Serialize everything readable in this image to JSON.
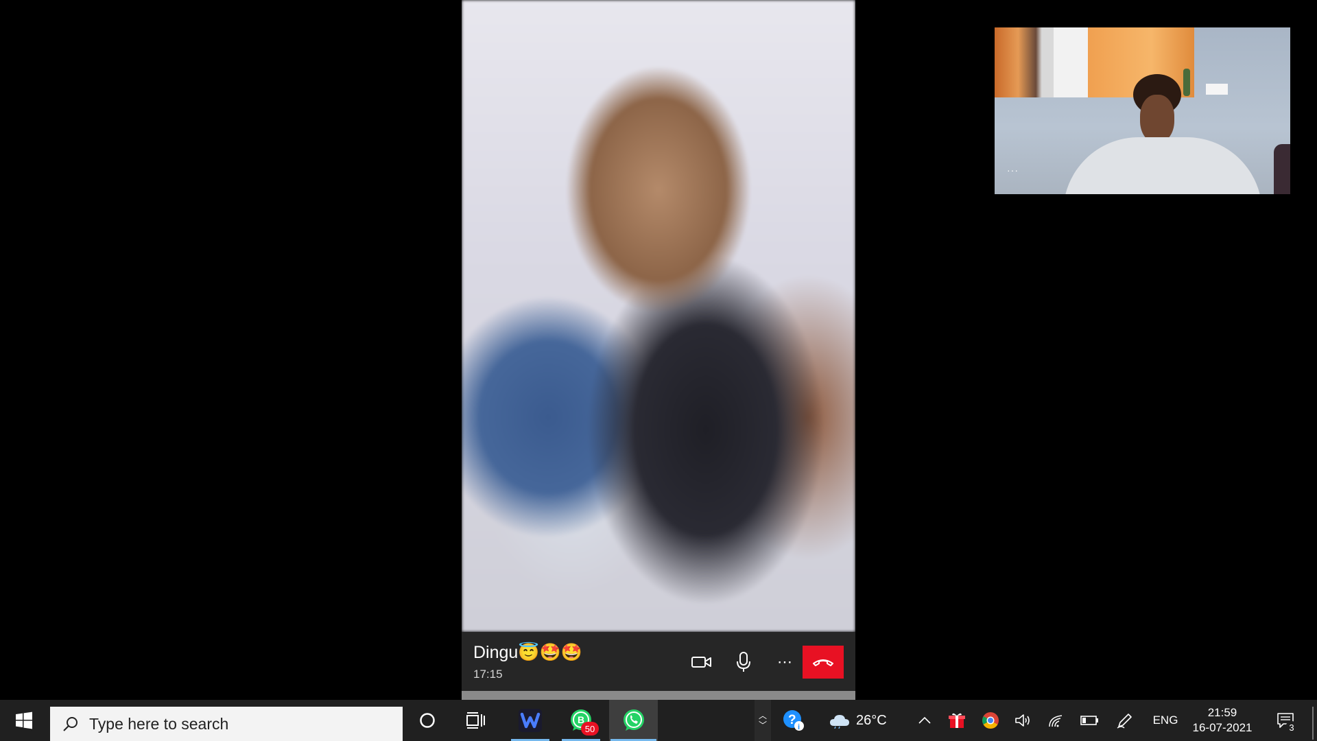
{
  "call": {
    "caller_name": "Dingu😇🤩🤩",
    "duration": "17:15",
    "end_call_color": "#e81123"
  },
  "taskbar": {
    "search_placeholder": "Type here to search",
    "whatsapp_business_badge": "50",
    "weather": {
      "temperature": "26°C",
      "icon": "cloud-icon"
    },
    "language": "ENG",
    "time": "21:59",
    "date": "16-07-2021",
    "notification_count": "3",
    "accent_color": "#76b9ed"
  }
}
